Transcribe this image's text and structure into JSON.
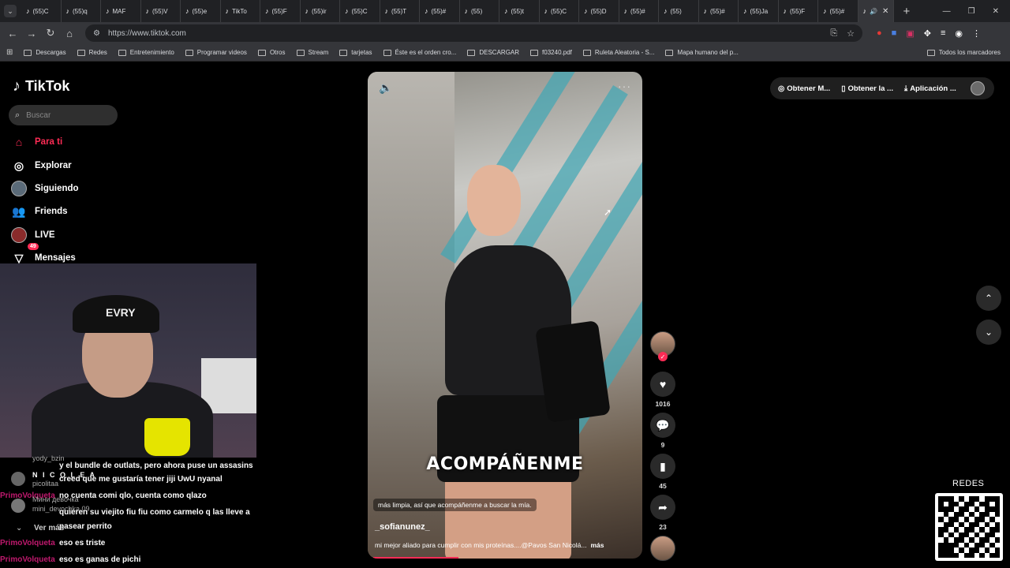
{
  "browser": {
    "tabs": [
      {
        "label": "(55)C"
      },
      {
        "label": "(55)q"
      },
      {
        "label": "MAF"
      },
      {
        "label": "(55)V"
      },
      {
        "label": "(55)e"
      },
      {
        "label": "TikTo"
      },
      {
        "label": "(55)F"
      },
      {
        "label": "(55)ir"
      },
      {
        "label": "(55)C"
      },
      {
        "label": "(55)T"
      },
      {
        "label": "(55)#"
      },
      {
        "label": "(55)"
      },
      {
        "label": "(55)t"
      },
      {
        "label": "(55)C"
      },
      {
        "label": "(55)D"
      },
      {
        "label": "(55)#"
      },
      {
        "label": "(55)"
      },
      {
        "label": "(55)#"
      },
      {
        "label": "(55)Ja"
      },
      {
        "label": "(55)F"
      },
      {
        "label": "(55)#"
      }
    ],
    "url": "https://www.tiktok.com",
    "bookmarks": [
      "Descargas",
      "Redes",
      "Entretenimiento",
      "Programar videos",
      "Otros",
      "Stream",
      "tarjetas",
      "Éste es el orden cro...",
      "DESCARGAR",
      "f03240.pdf",
      "Ruleta Aleatoria - S...",
      "Mapa humano del p..."
    ],
    "bookmarks_right": "Todos los marcadores"
  },
  "sidebar": {
    "logo": "TikTok",
    "search_placeholder": "Buscar",
    "items": [
      {
        "label": "Para ti",
        "icon": "home-icon",
        "active": true
      },
      {
        "label": "Explorar",
        "icon": "compass-icon"
      },
      {
        "label": "Siguiendo",
        "icon": "avatar"
      },
      {
        "label": "Friends",
        "icon": "friends-icon"
      },
      {
        "label": "LIVE",
        "icon": "live-icon"
      },
      {
        "label": "Mensajes",
        "icon": "messages-icon",
        "badge": "49"
      }
    ]
  },
  "webcam": {
    "cap_text": "EVRY"
  },
  "chat": {
    "lines": [
      {
        "user": "yody_bzin",
        "msg": ""
      },
      {
        "user": "",
        "msg": "y el bundle de outlats, pero ahora puse un assasins"
      },
      {
        "user": "N I C O L E A",
        "msg": "creed que me gustaría tener jiji UwU nyanal"
      },
      {
        "user": "picolitaa",
        "msg": ""
      },
      {
        "user": "PrimoVolqueta",
        "msg": "no cuenta comi qlo, cuenta como qlazo"
      },
      {
        "user": "Мини девочка",
        "msg": ""
      },
      {
        "user": "mini_devochka.09",
        "msg": "quieren su viejito fiu fiu como carmelo q las lleve a"
      },
      {
        "user": "",
        "msg": "pasear perrito"
      },
      {
        "user": "Ver más",
        "msg": ""
      },
      {
        "user": "PrimoVolqueta",
        "msg": "eso es triste"
      },
      {
        "user": "PrimoVolqueta",
        "msg": "eso es ganas de pichi"
      }
    ]
  },
  "video": {
    "overlay_caption": "ACOMPÁÑENME",
    "subtitle": "más limpia, así que acompáñenme a buscar la mía.",
    "username": "_sofianunez_",
    "description": "mi mejor aliado para cumplir con mis proteínas....@Pavos San Nicolá...",
    "more_label": "más",
    "progress": 0.31
  },
  "actions": {
    "likes": "1016",
    "comments": "9",
    "saves": "45",
    "shares": "23"
  },
  "topbar": {
    "btn1": "Obtener M...",
    "btn2": "Obtener la ...",
    "btn3": "Aplicación ..."
  },
  "overlay": {
    "redes": "REDES"
  },
  "colors": {
    "accent": "#fe2c55",
    "chat_user": "#c0196e"
  }
}
